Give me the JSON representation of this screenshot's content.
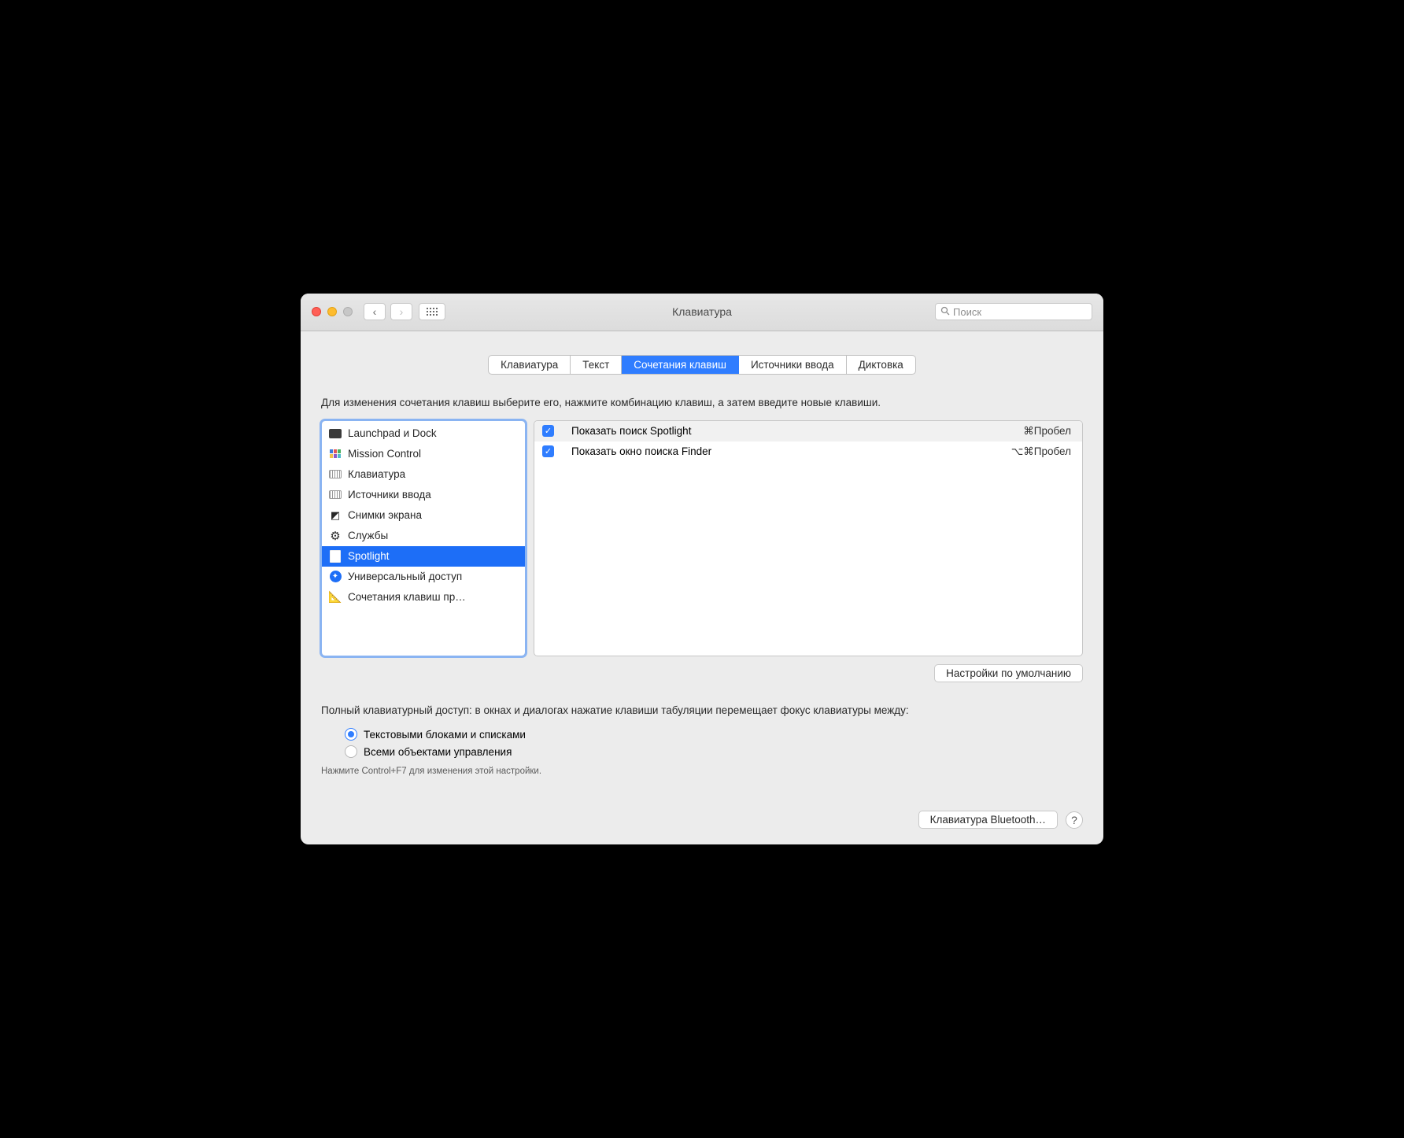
{
  "window": {
    "title": "Клавиатура"
  },
  "search": {
    "placeholder": "Поиск"
  },
  "tabs": [
    {
      "label": "Клавиатура",
      "active": false
    },
    {
      "label": "Текст",
      "active": false
    },
    {
      "label": "Сочетания клавиш",
      "active": true
    },
    {
      "label": "Источники ввода",
      "active": false
    },
    {
      "label": "Диктовка",
      "active": false
    }
  ],
  "instruction": "Для изменения сочетания клавиш выберите его, нажмите комбинацию клавиш, а затем введите новые клавиши.",
  "categories": [
    {
      "label": "Launchpad и Dock",
      "icon": "launchpad",
      "selected": false
    },
    {
      "label": "Mission Control",
      "icon": "mission",
      "selected": false
    },
    {
      "label": "Клавиатура",
      "icon": "keyboard",
      "selected": false
    },
    {
      "label": "Источники ввода",
      "icon": "keyboard",
      "selected": false
    },
    {
      "label": "Снимки экрана",
      "icon": "screenshot",
      "selected": false
    },
    {
      "label": "Службы",
      "icon": "services",
      "selected": false
    },
    {
      "label": "Spotlight",
      "icon": "spotlight",
      "selected": true
    },
    {
      "label": "Универсальный доступ",
      "icon": "access",
      "selected": false
    },
    {
      "label": "Сочетания клавиш пр…",
      "icon": "app",
      "selected": false
    }
  ],
  "shortcuts": [
    {
      "enabled": true,
      "label": "Показать поиск Spotlight",
      "combo": "⌘Пробел"
    },
    {
      "enabled": true,
      "label": "Показать окно поиска Finder",
      "combo": "⌥⌘Пробел"
    }
  ],
  "defaults_button": "Настройки по умолчанию",
  "access_text": "Полный клавиатурный доступ: в окнах и диалогах нажатие клавиши табуляции перемещает фокус клавиатуры между:",
  "radios": [
    {
      "label": "Текстовыми блоками и списками",
      "checked": true
    },
    {
      "label": "Всеми объектами управления",
      "checked": false
    }
  ],
  "hint": "Нажмите Control+F7 для изменения этой настройки.",
  "bluetooth_button": "Клавиатура Bluetooth…"
}
